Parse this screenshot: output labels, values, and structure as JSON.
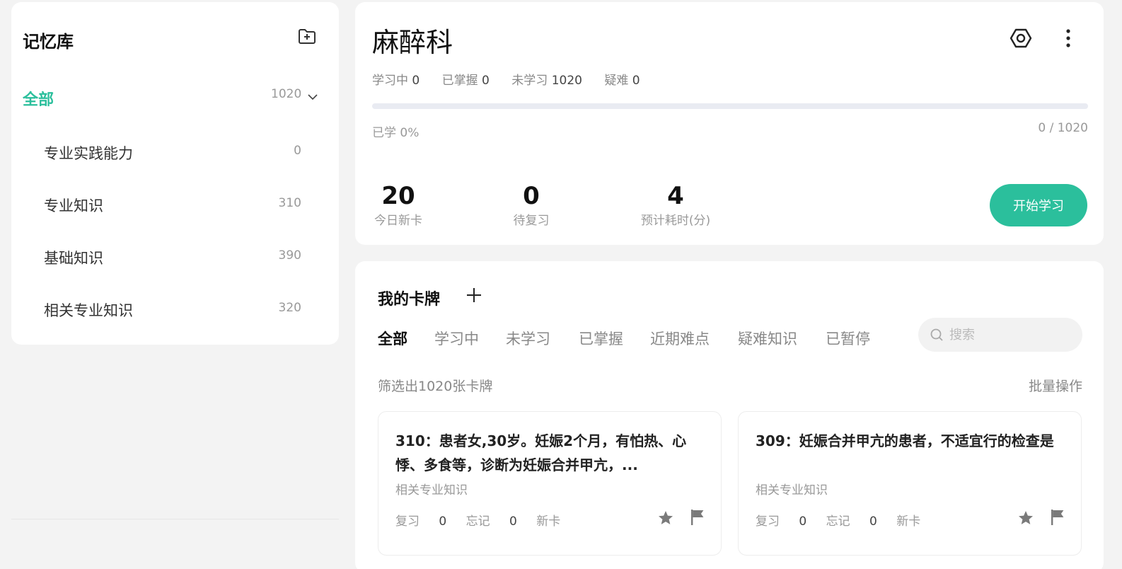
{
  "sidebar": {
    "title": "记忆库",
    "all_label": "全部",
    "all_count": "1020",
    "items": [
      {
        "label": "专业实践能力",
        "count": "0"
      },
      {
        "label": "专业知识",
        "count": "310"
      },
      {
        "label": "基础知识",
        "count": "390"
      },
      {
        "label": "相关专业知识",
        "count": "320"
      }
    ]
  },
  "deck": {
    "title": "麻醉科",
    "stats": [
      {
        "label": "学习中",
        "value": "0"
      },
      {
        "label": "已掌握",
        "value": "0"
      },
      {
        "label": "未学习",
        "value": "1020"
      },
      {
        "label": "疑难",
        "value": "0"
      }
    ],
    "progress_percent": 0,
    "progress_label": "已学 0%",
    "progress_count": "0 / 1020",
    "metrics": [
      {
        "value": "20",
        "caption": "今日新卡"
      },
      {
        "value": "0",
        "caption": "待复习"
      },
      {
        "value": "4",
        "caption": "预计耗时(分)"
      }
    ],
    "start_button": "开始学习"
  },
  "cards_section": {
    "title": "我的卡牌",
    "tabs": [
      "全部",
      "学习中",
      "未学习",
      "已掌握",
      "近期难点",
      "疑难知识",
      "已暂停"
    ],
    "active_tab": 0,
    "search_placeholder": "搜索",
    "search_value": "",
    "filter_text": "筛选出1020张卡牌",
    "batch_label": "批量操作",
    "cards": [
      {
        "question": "310：患者女,30岁。妊娠2个月，有怕热、心悸、多食等，诊断为妊娠合并甲亢，...",
        "category": "相关专业知识",
        "review_label": "复习",
        "review_count": "0",
        "forget_label": "忘记",
        "forget_count": "0",
        "status": "新卡"
      },
      {
        "question": "309：妊娠合并甲亢的患者，不适宜行的检查是",
        "category": "相关专业知识",
        "review_label": "复习",
        "review_count": "0",
        "forget_label": "忘记",
        "forget_count": "0",
        "status": "新卡"
      }
    ]
  },
  "colors": {
    "accent": "#2bbf9c",
    "page_bg": "#f3f3f3",
    "panel_bg": "#ffffff",
    "progress_track": "#e9ebf2"
  }
}
